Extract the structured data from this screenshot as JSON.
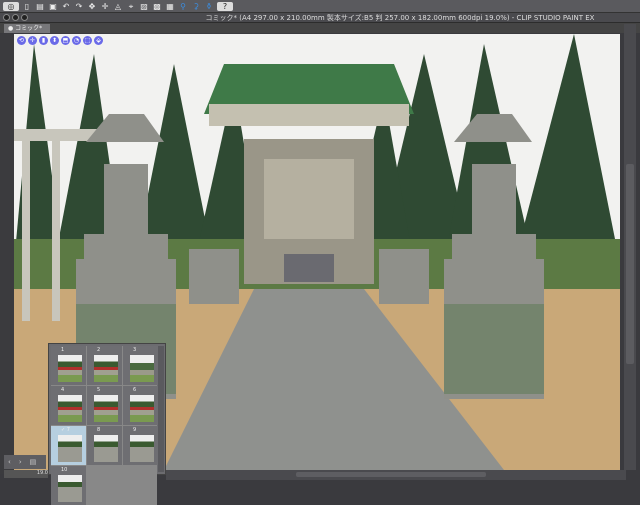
{
  "toolbar": {
    "icons": [
      "clip-studio-logo",
      "new-icon",
      "open-icon",
      "save-icon",
      "undo-icon",
      "redo-icon",
      "transform-icon",
      "move-icon",
      "fill-icon",
      "cursor-icon",
      "snap-ruler-icon",
      "snap-grid-icon",
      "snap-special-icon",
      "help-icon"
    ],
    "glyphs": [
      "◎",
      "▯",
      "▤",
      "▣",
      "↶",
      "↷",
      "✥",
      "✛",
      "◬",
      "⌖",
      "▨",
      "▩",
      "▦",
      "⚲",
      "⚳",
      "⚱",
      "?"
    ]
  },
  "window": {
    "title": "コミック* (A4 297.00 x 210.00mm 製本サイズ:B5 判 257.00 x 182.00mm 600dpi 19.0%) - CLIP STUDIO PAINT EX"
  },
  "tab": {
    "label": "コミック*"
  },
  "object_launcher": [
    "⟲",
    "✛",
    "▮",
    "⬍",
    "⬒",
    "◔",
    "⬚",
    "⬙"
  ],
  "page_panel": {
    "pages": [
      {
        "n": "1",
        "k": "r"
      },
      {
        "n": "2",
        "k": "r"
      },
      {
        "n": "3",
        "k": ""
      },
      {
        "n": "4",
        "k": "r"
      },
      {
        "n": "5",
        "k": "r"
      },
      {
        "n": "6",
        "k": "r"
      },
      {
        "n": "7",
        "k": "g",
        "sel": true
      },
      {
        "n": "8",
        "k": "g"
      },
      {
        "n": "9",
        "k": "g"
      },
      {
        "n": "10",
        "k": "g"
      }
    ],
    "check": "✓"
  },
  "navigator": {
    "prev": "‹",
    "next": "›",
    "zoom": "19.0"
  },
  "colors": {
    "sand": "#c9a878",
    "stone": "#8f918e",
    "foliage": "#2f4a33",
    "roof": "#3f7a48"
  }
}
